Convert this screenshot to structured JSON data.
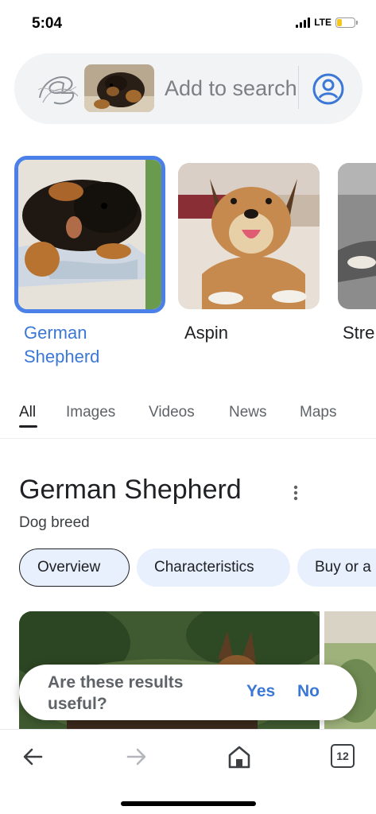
{
  "status_bar": {
    "time": "5:04",
    "network": "LTE",
    "battery_level": 0.3,
    "battery_color": "#f5c51c"
  },
  "search": {
    "placeholder": "Add to search",
    "logo_icon": "google-lens-logo",
    "account_icon": "account-circle-icon"
  },
  "carousel": {
    "items": [
      {
        "label_line1": "German",
        "label_line2": "Shepherd",
        "selected": true
      },
      {
        "label_line1": "Aspin",
        "label_line2": "",
        "selected": false
      },
      {
        "label_line1": "Stre",
        "label_line2": "",
        "selected": false
      }
    ]
  },
  "tabs": [
    {
      "label": "All",
      "active": true
    },
    {
      "label": "Images",
      "active": false
    },
    {
      "label": "Videos",
      "active": false
    },
    {
      "label": "News",
      "active": false
    },
    {
      "label": "Maps",
      "active": false
    }
  ],
  "knowledge_panel": {
    "title": "German Shepherd",
    "subtitle": "Dog breed",
    "chips": [
      {
        "label": "Overview",
        "active": true
      },
      {
        "label": "Characteristics",
        "active": false
      },
      {
        "label": "Buy or a",
        "active": false
      }
    ]
  },
  "feedback": {
    "question": "Are these results useful?",
    "yes_label": "Yes",
    "no_label": "No"
  },
  "bottom_bar": {
    "tab_count": "12"
  },
  "colors": {
    "accent": "#3b78d6",
    "selected_border": "#4b80e8",
    "chip_bg": "#e8f0fe",
    "search_bg": "#f1f3f4"
  }
}
